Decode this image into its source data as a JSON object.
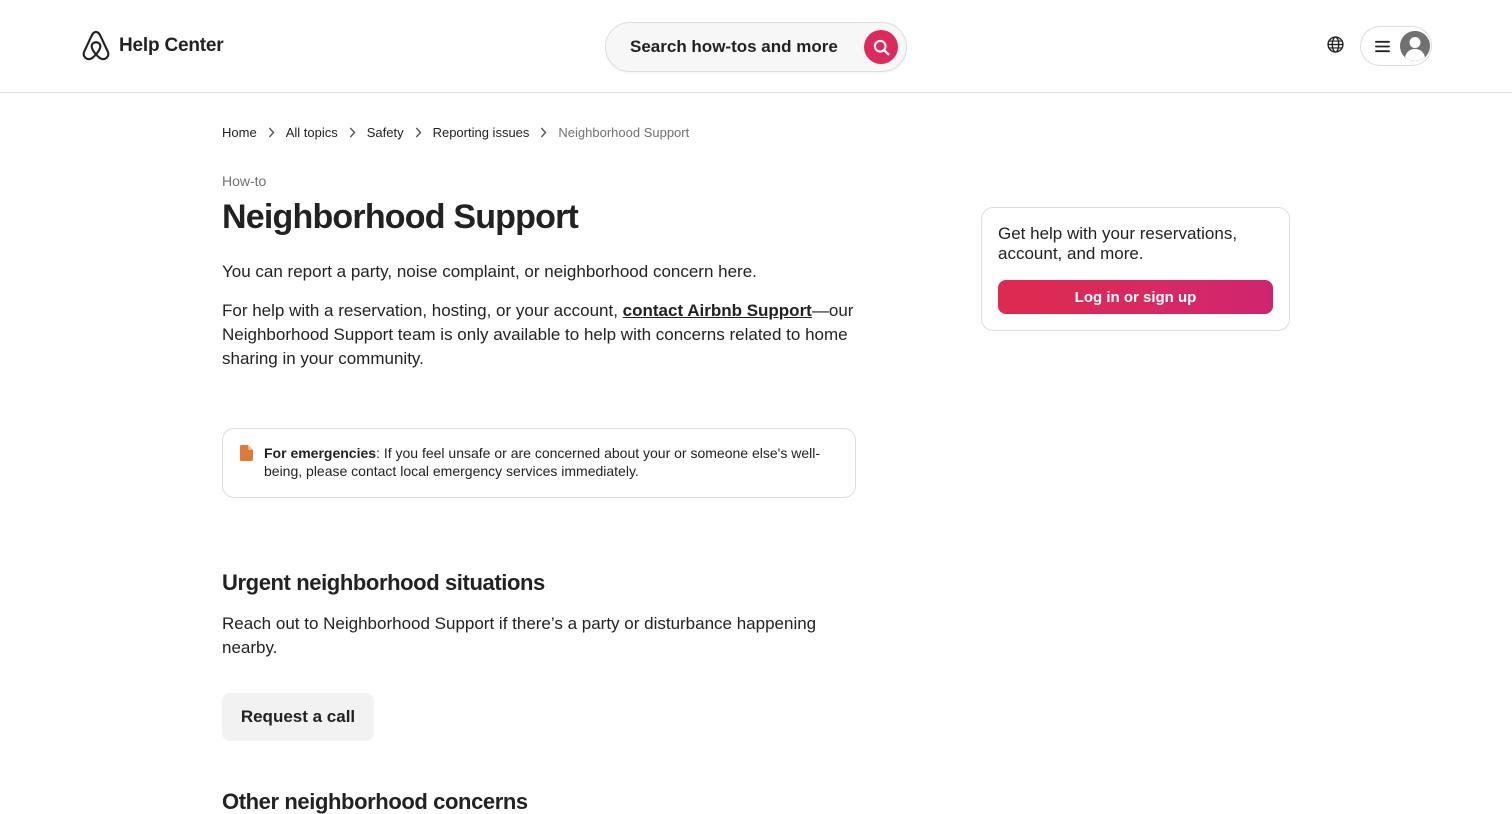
{
  "header": {
    "brand_text": "Help Center",
    "search_placeholder": "Search how-tos and more"
  },
  "breadcrumb": [
    {
      "label": "Home"
    },
    {
      "label": "All topics"
    },
    {
      "label": "Safety"
    },
    {
      "label": "Reporting issues"
    },
    {
      "label": "Neighborhood Support"
    }
  ],
  "article": {
    "kicker": "How-to",
    "title": "Neighborhood Support",
    "intro": "You can report a party, noise complaint, or neighborhood concern here.",
    "help_before_link": "For help with a reservation, hosting, or your account, ",
    "help_link": "contact Airbnb Support",
    "help_after_link": "—our Neighborhood Support team is only available to help with concerns related to home sharing in your community.",
    "notice_bold": "For emergencies",
    "notice_text": ": If you feel unsafe or are concerned about your or someone else's well-being, please contact local emergency services immediately.",
    "section1_title": "Urgent neighborhood situations",
    "section1_text": "Reach out to Neighborhood Support if there’s a party or disturbance happening nearby.",
    "request_call_label": "Request a call",
    "section2_title": "Other neighborhood concerns"
  },
  "sidebar": {
    "text": "Get help with your reservations, account, and more.",
    "login_label": "Log in or sign up"
  },
  "colors": {
    "brand": "#dd2a5e",
    "notice_icon": "#e07a37",
    "border": "#dddddd",
    "muted_text": "#717171"
  },
  "icons": {
    "brand": "airbnb-logo-icon",
    "search": "search-icon",
    "globe": "globe-icon",
    "menu": "hamburger-menu-icon",
    "avatar": "user-avatar-icon",
    "breadcrumb_separator": "chevron-right-icon",
    "notice": "document-icon"
  }
}
